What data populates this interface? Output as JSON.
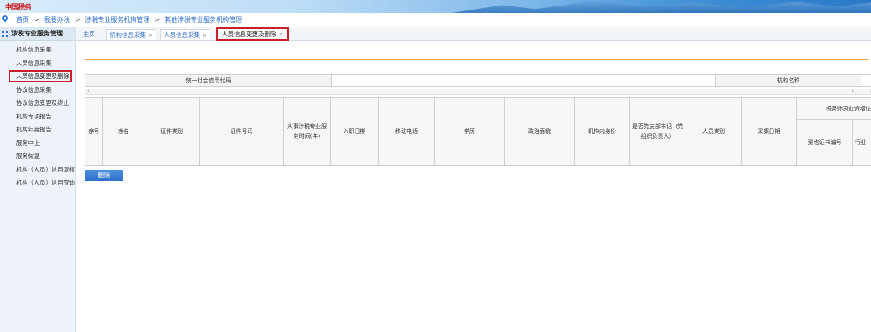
{
  "banner": {
    "logo_text": "中国税务"
  },
  "breadcrumb": {
    "items": [
      "首页",
      "我要办税",
      "涉税专业服务机构管理",
      "其他涉税专业服务机构管理"
    ],
    "separator": ">"
  },
  "sidebar": {
    "title": "涉税专业服务管理",
    "items": [
      "机构信息采集",
      "人员信息采集",
      "人员信息变更及删除",
      "协议信息采集",
      "协议信息变更及终止",
      "机构专项报告",
      "机构年度报告",
      "服务中止",
      "服务恢复",
      "机构（人员）信用复核",
      "机构（人员）信用查询"
    ],
    "active_index": 2
  },
  "tabs": {
    "items": [
      {
        "label": "主页",
        "closable": false
      },
      {
        "label": "机构信息采集",
        "closable": true
      },
      {
        "label": "人员信息采集",
        "closable": true
      },
      {
        "label": "人员信息变更及删除",
        "closable": true
      }
    ],
    "close_glyph": "×",
    "active_index": 3
  },
  "top_table": {
    "credit_code_label": "统一社会信用代码",
    "credit_code_value": "",
    "org_name_label": "机构名称",
    "org_name_value": ""
  },
  "scroll": {
    "left_arrow": "‹",
    "right_arrow": "›"
  },
  "columns": {
    "seq": "序号",
    "name": "姓名",
    "id_type": "证件类别",
    "id_number": "证件号码",
    "years": "从事涉税专业服务时间(年)",
    "entry_date": "入职日期",
    "mobile": "移动电话",
    "education": "学历",
    "political": "政治面貌",
    "position": "机构内身份",
    "party_secretary": "是否党支部书记（党组织负责人）",
    "person_type": "人员类别",
    "collect_date": "采集日期",
    "qualification_group": "税务师执业资格证书",
    "cert_number": "资格证书编号",
    "industry": "行业"
  },
  "actions": {
    "delete_label": "删除"
  },
  "colors": {
    "accent": "#2f6fc7",
    "highlight": "#c8202a",
    "rule": "#f0a342"
  }
}
